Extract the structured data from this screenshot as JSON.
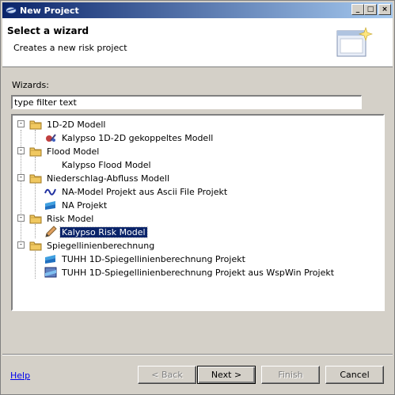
{
  "window": {
    "title": "New Project"
  },
  "header": {
    "title": "Select a wizard",
    "description": "Creates a new risk project"
  },
  "wizards_label": "Wizards:",
  "filter": {
    "value": "type filter text"
  },
  "tree": [
    {
      "label": "1D-2D Modell",
      "children": [
        {
          "label": "Kalypso 1D-2D gekoppeltes Modell"
        }
      ]
    },
    {
      "label": "Flood Model",
      "children": [
        {
          "label": "Kalypso Flood Model"
        }
      ]
    },
    {
      "label": "Niederschlag-Abfluss Modell",
      "children": [
        {
          "label": "NA-Model Projekt aus Ascii File Projekt"
        },
        {
          "label": "NA Projekt"
        }
      ]
    },
    {
      "label": "Risk Model",
      "children": [
        {
          "label": "Kalypso Risk Model"
        }
      ]
    },
    {
      "label": "Spiegellinienberechnung",
      "children": [
        {
          "label": "TUHH 1D-Spiegellinienberechnung Projekt"
        },
        {
          "label": "TUHH 1D-Spiegellinienberechnung Projekt aus WspWin Projekt"
        }
      ]
    }
  ],
  "buttons": {
    "help": "Help",
    "back": "< Back",
    "next": "Next >",
    "finish": "Finish",
    "cancel": "Cancel"
  },
  "title_buttons": {
    "minimize": "_",
    "maximize": "□",
    "close": "×"
  },
  "colors": {
    "selection": "#0a246a",
    "titlebar": "#0a246a",
    "folder": "#f0c040"
  }
}
